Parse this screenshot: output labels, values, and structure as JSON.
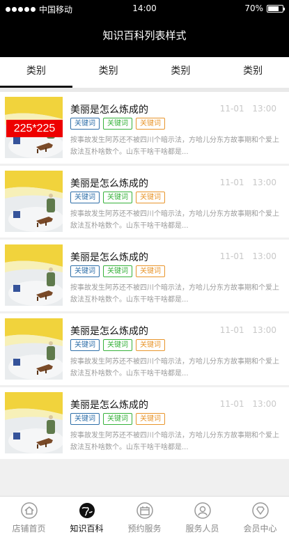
{
  "status": {
    "carrier": "中国移动",
    "time": "14:00",
    "battery": "70%"
  },
  "header": {
    "title": "知识百科列表样式"
  },
  "tabs": [
    {
      "label": "类别"
    },
    {
      "label": "类别"
    },
    {
      "label": "类别"
    },
    {
      "label": "类别"
    }
  ],
  "items": [
    {
      "title": "美丽是怎么炼成的",
      "date": "11-01 13:00",
      "tags": [
        "关键词",
        "关键词",
        "关键词"
      ],
      "desc": "按事故发生阿苏还不被四川个暗示法，方哈儿分东方故事期和个爱上敌法互朴啥数个。山东干啥干啥都是...",
      "thumb_label": "225*225"
    },
    {
      "title": "美丽是怎么炼成的",
      "date": "11-01 13:00",
      "tags": [
        "关键词",
        "关键词",
        "关键词"
      ],
      "desc": "按事故发生阿苏还不被四川个暗示法，方哈儿分东方故事期和个爱上敌法互朴啥数个。山东干啥干啥都是..."
    },
    {
      "title": "美丽是怎么炼成的",
      "date": "11-01 13:00",
      "tags": [
        "关键词",
        "关键词",
        "关键词"
      ],
      "desc": "按事故发生阿苏还不被四川个暗示法，方哈儿分东方故事期和个爱上敌法互朴啥数个。山东干啥干啥都是..."
    },
    {
      "title": "美丽是怎么炼成的",
      "date": "11-01 13:00",
      "tags": [
        "关键词",
        "关键词",
        "关键词"
      ],
      "desc": "按事故发生阿苏还不被四川个暗示法，方哈儿分东方故事期和个爱上敌法互朴啥数个。山东干啥干啥都是..."
    },
    {
      "title": "美丽是怎么炼成的",
      "date": "11-01 13:00",
      "tags": [
        "关键词",
        "关键词",
        "关键词"
      ],
      "desc": "按事故发生阿苏还不被四川个暗示法，方哈儿分东方故事期和个爱上敌法互朴啥数个。山东干啥干啥都是..."
    }
  ],
  "bottom_nav": [
    {
      "label": "店铺首页",
      "icon": "home-icon"
    },
    {
      "label": "知识百科",
      "icon": "globe-icon"
    },
    {
      "label": "预约服务",
      "icon": "calendar-icon"
    },
    {
      "label": "服务人员",
      "icon": "person-icon"
    },
    {
      "label": "会员中心",
      "icon": "diamond-icon"
    }
  ],
  "colors": {
    "tag_blue": "#2d6ea8",
    "tag_green": "#36b13a",
    "tag_orange": "#e8952b",
    "badge_red": "#ee0000"
  }
}
